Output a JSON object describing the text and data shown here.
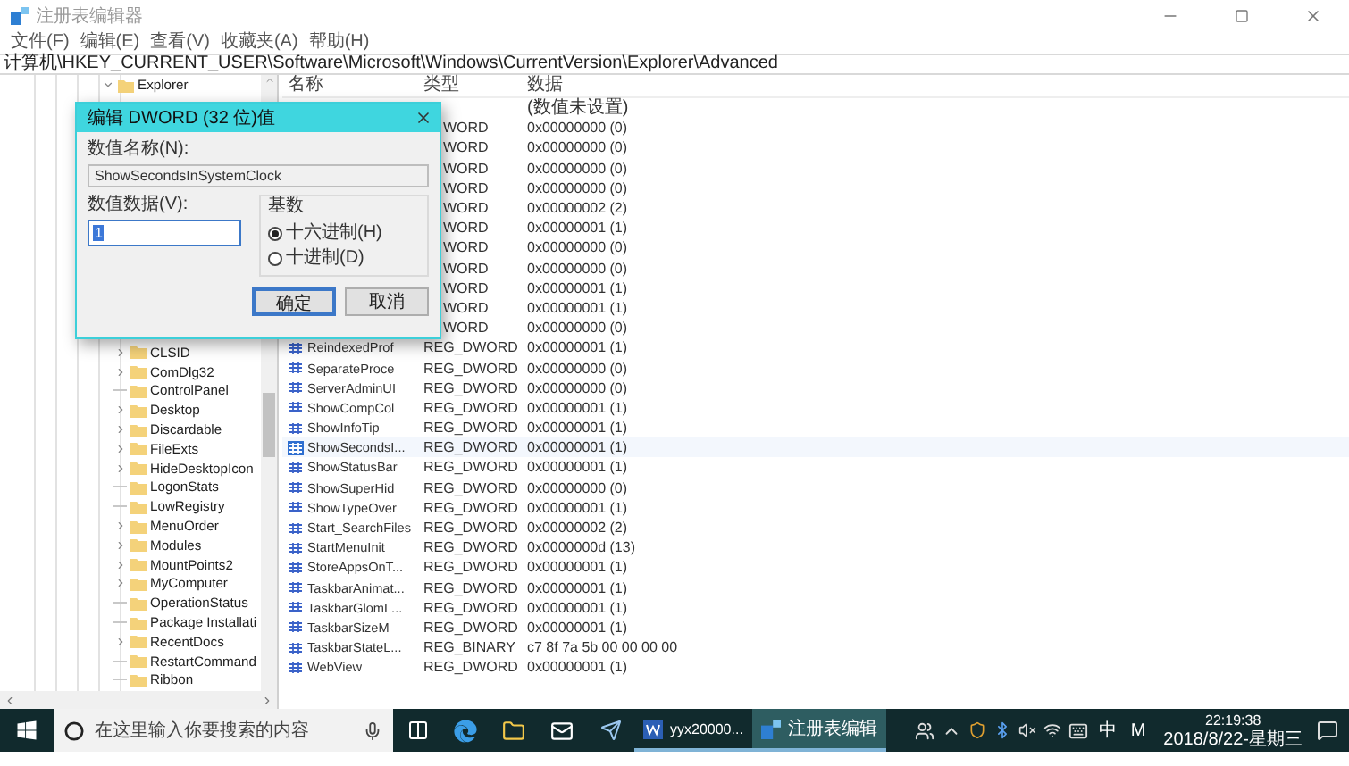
{
  "window": {
    "title": "注册表编辑器"
  },
  "menu": [
    "文件(F)",
    "编辑(E)",
    "查看(V)",
    "收藏夹(A)",
    "帮助(H)"
  ],
  "address": "计算机\\HKEY_CURRENT_USER\\Software\\Microsoft\\Windows\\CurrentVersion\\Explorer\\Advanced",
  "tree": [
    {
      "label": "Explorer",
      "kind": "expanded",
      "children": [
        {
          "label": "CLSID",
          "kind": "collapsed"
        },
        {
          "label": "ComDlg32",
          "kind": "collapsed"
        },
        {
          "label": "ControlPanel",
          "kind": "leaf"
        },
        {
          "label": "Desktop",
          "kind": "collapsed"
        },
        {
          "label": "Discardable",
          "kind": "collapsed"
        },
        {
          "label": "FileExts",
          "kind": "collapsed"
        },
        {
          "label": "HideDesktopIcon",
          "kind": "collapsed"
        },
        {
          "label": "LogonStats",
          "kind": "leaf"
        },
        {
          "label": "LowRegistry",
          "kind": "leaf"
        },
        {
          "label": "MenuOrder",
          "kind": "collapsed"
        },
        {
          "label": "Modules",
          "kind": "collapsed"
        },
        {
          "label": "MountPoints2",
          "kind": "collapsed"
        },
        {
          "label": "MyComputer",
          "kind": "collapsed"
        },
        {
          "label": "OperationStatus",
          "kind": "leaf"
        },
        {
          "label": "Package Installati",
          "kind": "leaf"
        },
        {
          "label": "RecentDocs",
          "kind": "collapsed"
        },
        {
          "label": "RestartCommand",
          "kind": "leaf"
        },
        {
          "label": "Ribbon",
          "kind": "leaf"
        }
      ]
    }
  ],
  "values": {
    "columns": [
      "名称",
      "类型",
      "数据"
    ],
    "rows": [
      {
        "data": "(数值未设置)",
        "selected": false
      },
      {
        "type": "WORD",
        "data": "0x00000000 (0)",
        "selected": false
      },
      {
        "type": "WORD",
        "data": "0x00000000 (0)",
        "selected": false
      },
      {
        "type": "WORD",
        "data": "0x00000000 (0)",
        "selected": false
      },
      {
        "type": "WORD",
        "data": "0x00000000 (0)",
        "selected": false
      },
      {
        "type": "WORD",
        "data": "0x00000002 (2)",
        "selected": false
      },
      {
        "type": "WORD",
        "data": "0x00000001 (1)",
        "selected": false
      },
      {
        "type": "WORD",
        "data": "0x00000000 (0)",
        "selected": false
      },
      {
        "type": "WORD",
        "data": "0x00000000 (0)",
        "selected": false
      },
      {
        "type": "WORD",
        "data": "0x00000001 (1)",
        "selected": false
      },
      {
        "type": "WORD",
        "data": "0x00000001 (1)",
        "selected": false
      },
      {
        "type": "WORD",
        "data": "0x00000000 (0)",
        "selected": false
      },
      {
        "name": "ReindexedProf",
        "type": "REG_DWORD",
        "data": "0x00000001 (1)",
        "selected": false
      },
      {
        "name": "SeparateProce",
        "type": "REG_DWORD",
        "data": "0x00000000 (0)",
        "selected": false
      },
      {
        "name": "ServerAdminUI",
        "type": "REG_DWORD",
        "data": "0x00000000 (0)",
        "selected": false
      },
      {
        "name": "ShowCompCol",
        "type": "REG_DWORD",
        "data": "0x00000001 (1)",
        "selected": false
      },
      {
        "name": "ShowInfoTip",
        "type": "REG_DWORD",
        "data": "0x00000001 (1)",
        "selected": false
      },
      {
        "name": "ShowSecondsI...",
        "type": "REG_DWORD",
        "data": "0x00000001 (1)",
        "selected": true
      },
      {
        "name": "ShowStatusBar",
        "type": "REG_DWORD",
        "data": "0x00000001 (1)",
        "selected": false
      },
      {
        "name": "ShowSuperHid",
        "type": "REG_DWORD",
        "data": "0x00000000 (0)",
        "selected": false
      },
      {
        "name": "ShowTypeOver",
        "type": "REG_DWORD",
        "data": "0x00000001 (1)",
        "selected": false
      },
      {
        "name": "Start_SearchFiles",
        "type": "REG_DWORD",
        "data": "0x00000002 (2)",
        "selected": false
      },
      {
        "name": "StartMenuInit",
        "type": "REG_DWORD",
        "data": "0x0000000d (13)",
        "selected": false
      },
      {
        "name": "StoreAppsOnT...",
        "type": "REG_DWORD",
        "data": "0x00000001 (1)",
        "selected": false
      },
      {
        "name": "TaskbarAnimat...",
        "type": "REG_DWORD",
        "data": "0x00000001 (1)",
        "selected": false
      },
      {
        "name": "TaskbarGlomL...",
        "type": "REG_DWORD",
        "data": "0x00000001 (1)",
        "selected": false
      },
      {
        "name": "TaskbarSizeM",
        "type": "REG_DWORD",
        "data": "0x00000001 (1)",
        "selected": false
      },
      {
        "name": "TaskbarStateL...",
        "type": "REG_BINARY",
        "data": "c7 8f 7a 5b 00 00 00 00",
        "selected": false
      },
      {
        "name": "WebView",
        "type": "REG_DWORD",
        "data": "0x00000001 (1)",
        "selected": false
      }
    ]
  },
  "dialog": {
    "title": "编辑 DWORD (32 位)值",
    "name_label": "数值名称(N):",
    "name_value": "ShowSecondsInSystemClock",
    "data_label": "数值数据(V):",
    "data_value": "1",
    "data_value_selected": true,
    "base_label": "基数",
    "bases": [
      {
        "label": "十六进制(H)",
        "selected": true
      },
      {
        "label": "十进制(D)",
        "selected": false
      }
    ],
    "buttons": [
      {
        "label": "确定",
        "default": true
      },
      {
        "label": "取消",
        "default": false
      }
    ]
  },
  "taskbar": {
    "search_placeholder": "在这里输入你要搜索的内容",
    "apps": [
      {
        "kind": "taskview"
      },
      {
        "kind": "edge"
      },
      {
        "kind": "explorer"
      },
      {
        "kind": "mail"
      },
      {
        "kind": "bird"
      },
      {
        "kind": "word",
        "label": "yyx20000...",
        "selected": false
      },
      {
        "kind": "regedit",
        "label": "注册表编辑",
        "selected": true
      }
    ],
    "ime": "中",
    "mode": "M",
    "time": "22:19:38",
    "date": "2018/8/22-星期三"
  }
}
